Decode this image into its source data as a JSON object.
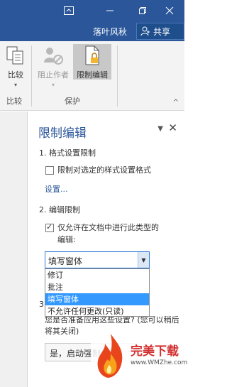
{
  "titlebar": {
    "user_name": "落叶风秋",
    "share_label": "共享",
    "icons": [
      "ribbon-display-options-icon",
      "minimize-icon",
      "restore-icon",
      "close-icon"
    ]
  },
  "ribbon": {
    "groups": [
      {
        "label": "比较",
        "buttons": [
          {
            "label": "比较",
            "icon": "compare-icon",
            "disabled": false
          }
        ]
      },
      {
        "label": "保护",
        "buttons": [
          {
            "label": "阻止作者",
            "icon": "block-authors-icon",
            "disabled": true
          },
          {
            "label": "限制编辑",
            "icon": "restrict-editing-icon",
            "disabled": false,
            "active": true
          }
        ]
      }
    ]
  },
  "pane": {
    "title": "限制编辑",
    "section1_title": "1. 格式设置限制",
    "format_checkbox_label": "限制对选定的样式设置格式",
    "format_checked": false,
    "settings_link": "设置...",
    "section2_title": "2. 编辑限制",
    "edit_checkbox_label_line1": "仅允许在文档中进行此类型的",
    "edit_checkbox_label_line2": "编辑:",
    "edit_checked": true,
    "select_value": "填写窗体",
    "options": [
      "修订",
      "批注",
      "填写窗体",
      "不允许任何更改(只读)"
    ],
    "selected_option_index": 2,
    "section3_num": "3",
    "question": "您是否准备应用这些设置? (您可以稍后将其关闭)",
    "start_button": "是，启动强制保护"
  },
  "watermark": {
    "brand": "完美下载",
    "url": "www.WMZhe.com"
  }
}
